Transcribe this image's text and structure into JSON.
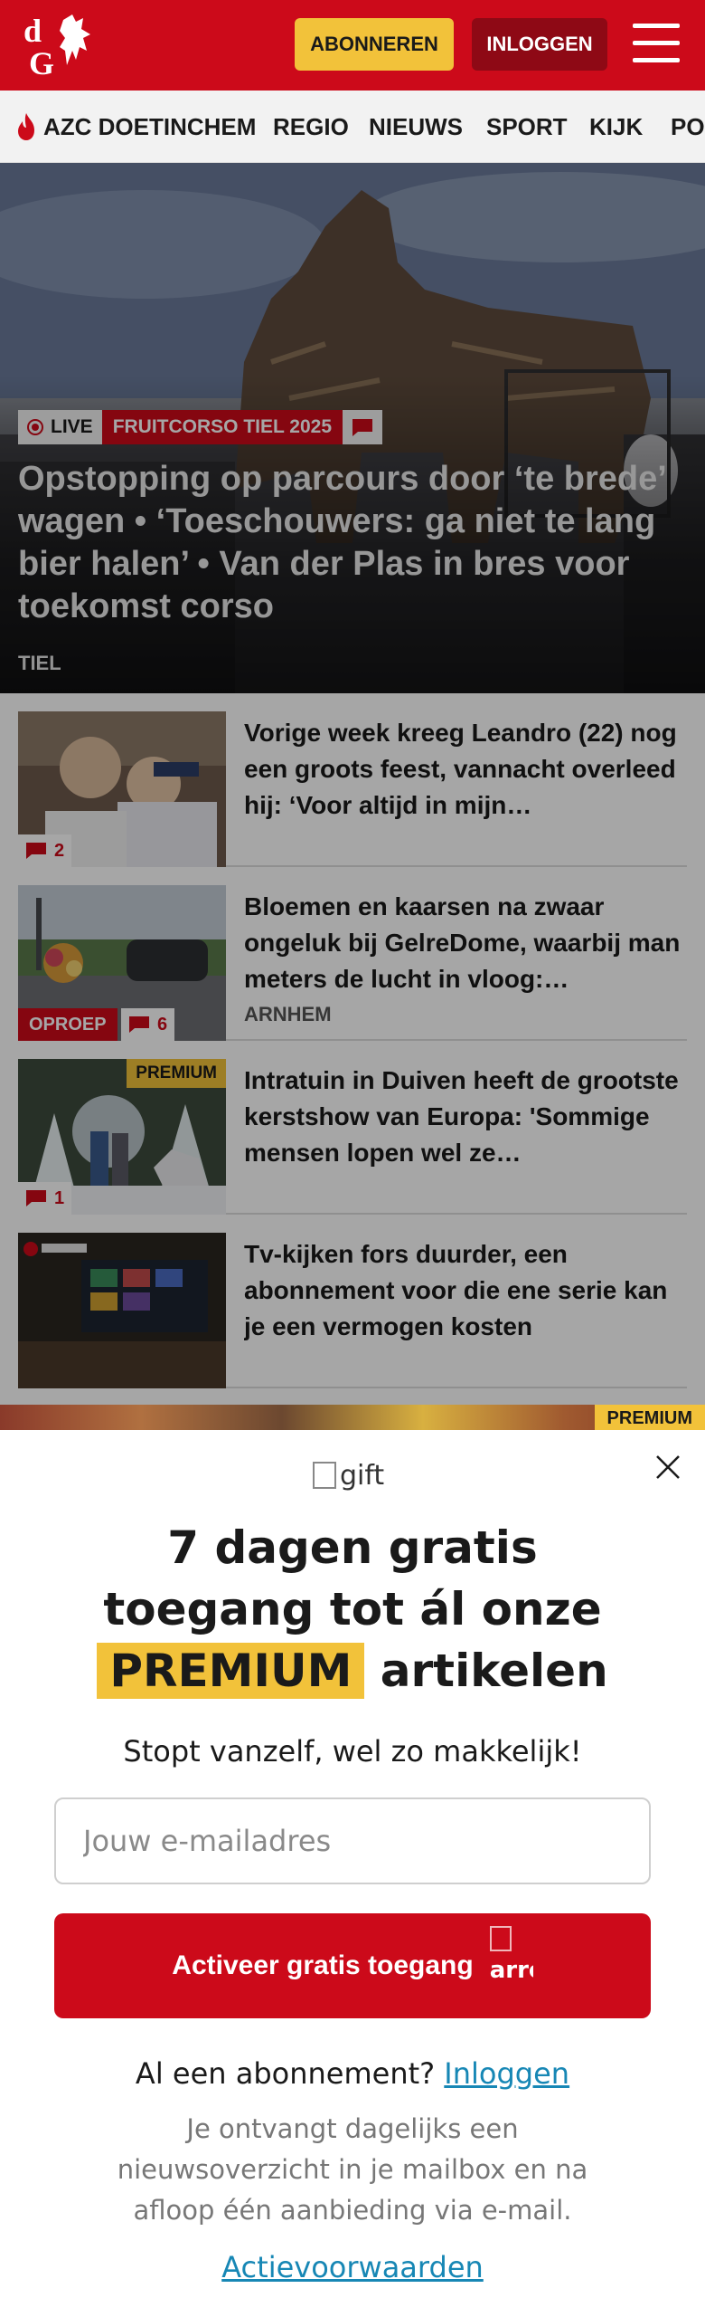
{
  "header": {
    "logo_text": "dG",
    "subscribe_label": "ABONNEREN",
    "login_label": "INLOGGEN"
  },
  "nav": {
    "items": [
      {
        "label": "AZC DOETINCHEM",
        "icon": "flame-icon"
      },
      {
        "label": "REGIO"
      },
      {
        "label": "NIEUWS"
      },
      {
        "label": "SPORT"
      },
      {
        "label": "KIJK"
      },
      {
        "label": "PO"
      }
    ]
  },
  "hero": {
    "live_label": "LIVE",
    "category": "FRUITCORSO TIEL 2025",
    "title": "Opstopping op parcours door ‘te brede’ wagen • ‘Toeschouwers: ga niet te lang bier halen’ • Van der Plas in bres voor toekomst corso",
    "location": "TIEL"
  },
  "articles": [
    {
      "title": "Vorige week kreeg Leandro (22) nog een groots feest, vannacht overleed hij: ‘Voor altijd in mijn…",
      "comments": "2",
      "location": "",
      "oproep": "",
      "premium": ""
    },
    {
      "title": "Bloemen en kaarsen na zwaar ongeluk bij GelreDome, waarbij man meters de lucht in vloog:…",
      "comments": "6",
      "location": "ARNHEM",
      "oproep": "OPROEP",
      "premium": ""
    },
    {
      "title": "Intratuin in Duiven heeft de grootste kerstshow van Europa: 'Sommige mensen lopen wel ze…",
      "comments": "1",
      "location": "",
      "oproep": "",
      "premium": "PREMIUM"
    },
    {
      "title": "Tv-kijken fors duurder, een abonnement voor die ene serie kan je een vermogen kosten",
      "comments": "",
      "location": "",
      "oproep": "",
      "premium": ""
    }
  ],
  "peek": {
    "premium": "PREMIUM"
  },
  "modal": {
    "gift_alt": "gift",
    "headline_line1": "7 dagen gratis",
    "headline_line2": "toegang tot ál onze",
    "headline_premium": "PREMIUM",
    "headline_tail": "artikelen",
    "subline": "Stopt vanzelf, wel zo makkelijk!",
    "email_placeholder": "Jouw e-mailadres",
    "cta_label": "Activeer gratis toegang",
    "cta_arrow_alt": "arrow right",
    "already_text": "Al een abonnement?",
    "login_link": "Inloggen",
    "fineprint": "Je ontvangt dagelijks een nieuwsoverzicht in je mailbox en na afloop één aanbieding via e-mail.",
    "terms_link": "Actievoorwaarden"
  },
  "colors": {
    "brand_red": "#cc0a1a",
    "premium_yellow": "#f2c23a",
    "link_blue": "#1787b5"
  }
}
